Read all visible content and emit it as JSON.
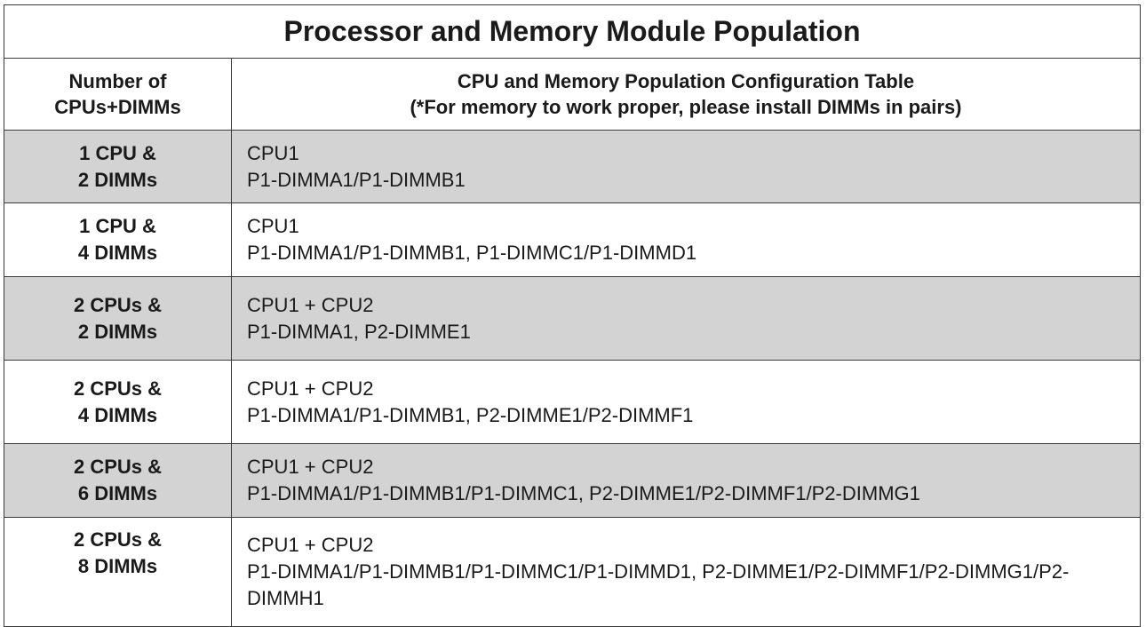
{
  "title": "Processor and Memory Module Population",
  "header": {
    "left_line1": "Number of",
    "left_line2": "CPUs+DIMMs",
    "right_line1": "CPU and Memory Population Configuration Table",
    "right_line2": "(*For memory to work proper, please install DIMMs in pairs)"
  },
  "rows": [
    {
      "count_line1": "1 CPU &",
      "count_line2": "2 DIMMs",
      "cpus": "CPU1",
      "dimms": "P1-DIMMA1/P1-DIMMB1",
      "shaded": true
    },
    {
      "count_line1": "1 CPU &",
      "count_line2": "4 DIMMs",
      "cpus": "CPU1",
      "dimms": "P1-DIMMA1/P1-DIMMB1, P1-DIMMC1/P1-DIMMD1",
      "shaded": false
    },
    {
      "count_line1": "2 CPUs &",
      "count_line2": "2 DIMMs",
      "cpus": "CPU1 + CPU2",
      "dimms": "P1-DIMMA1, P2-DIMME1",
      "shaded": true
    },
    {
      "count_line1": "2 CPUs &",
      "count_line2": "4 DIMMs",
      "cpus": "CPU1 + CPU2",
      "dimms": "P1-DIMMA1/P1-DIMMB1, P2-DIMME1/P2-DIMMF1",
      "shaded": false
    },
    {
      "count_line1": "2 CPUs &",
      "count_line2": "6 DIMMs",
      "cpus": "CPU1 + CPU2",
      "dimms": "P1-DIMMA1/P1-DIMMB1/P1-DIMMC1, P2-DIMME1/P2-DIMMF1/P2-DIMMG1",
      "shaded": true
    },
    {
      "count_line1": "2 CPUs &",
      "count_line2": "8 DIMMs",
      "cpus": "CPU1 + CPU2",
      "dimms": "P1-DIMMA1/P1-DIMMB1/P1-DIMMC1/P1-DIMMD1, P2-DIMME1/P2-DIMMF1/P2-DIMMG1/P2-DIMMH1",
      "shaded": false
    }
  ],
  "colors": {
    "shaded_row": "#d3d3d3",
    "border": "#3a3a3a",
    "text": "#1a1a1a"
  }
}
